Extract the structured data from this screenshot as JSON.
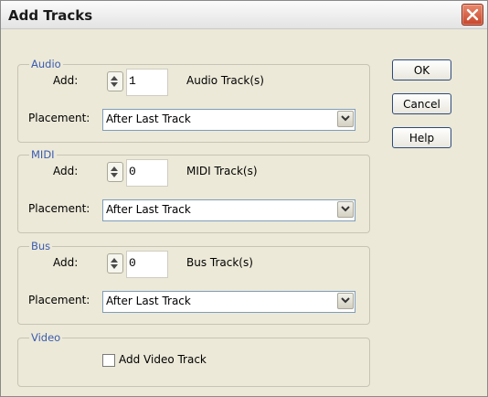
{
  "window": {
    "title": "Add Tracks"
  },
  "audio": {
    "legend": "Audio",
    "add_label": "Add:",
    "count": "1",
    "track_label": "Audio Track(s)",
    "placement_label": "Placement:",
    "placement_value": "After Last Track"
  },
  "midi": {
    "legend": "MIDI",
    "add_label": "Add:",
    "count": "0",
    "track_label": "MIDI Track(s)",
    "placement_label": "Placement:",
    "placement_value": "After Last Track"
  },
  "bus": {
    "legend": "Bus",
    "add_label": "Add:",
    "count": "0",
    "track_label": "Bus Track(s)",
    "placement_label": "Placement:",
    "placement_value": "After Last Track"
  },
  "video": {
    "legend": "Video",
    "checkbox_label": "Add Video Track",
    "checked": false
  },
  "buttons": {
    "ok": "OK",
    "cancel": "Cancel",
    "help": "Help"
  },
  "icons": {
    "close": "close-icon",
    "spinner": "spinner-arrows-icon",
    "dropdown": "chevron-down-icon"
  },
  "colors": {
    "dialog_bg": "#ece9d8",
    "legend_text": "#3a5bb0",
    "close_button": "#c8452a"
  }
}
